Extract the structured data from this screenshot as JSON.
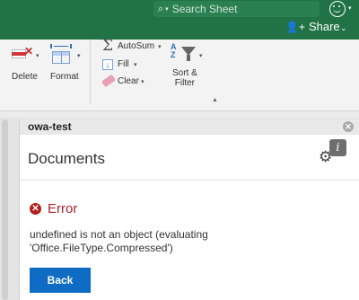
{
  "titlebar": {
    "search_placeholder": "Search Sheet",
    "share_label": "Share",
    "bg_color": "#217346"
  },
  "ribbon": {
    "delete_label": "Delete",
    "format_label": "Format",
    "autosum_label": "AutoSum",
    "fill_label": "Fill",
    "clear_label": "Clear",
    "sort_filter_line1": "Sort &",
    "sort_filter_line2": "Filter"
  },
  "taskpane": {
    "title": "owa-test",
    "heading": "Documents",
    "error_title": "Error",
    "error_message": "undefined is not an object (evaluating 'Office.FileType.Compressed')",
    "back_label": "Back",
    "accent_color": "#0f6cc4",
    "error_color": "#a4262c"
  }
}
